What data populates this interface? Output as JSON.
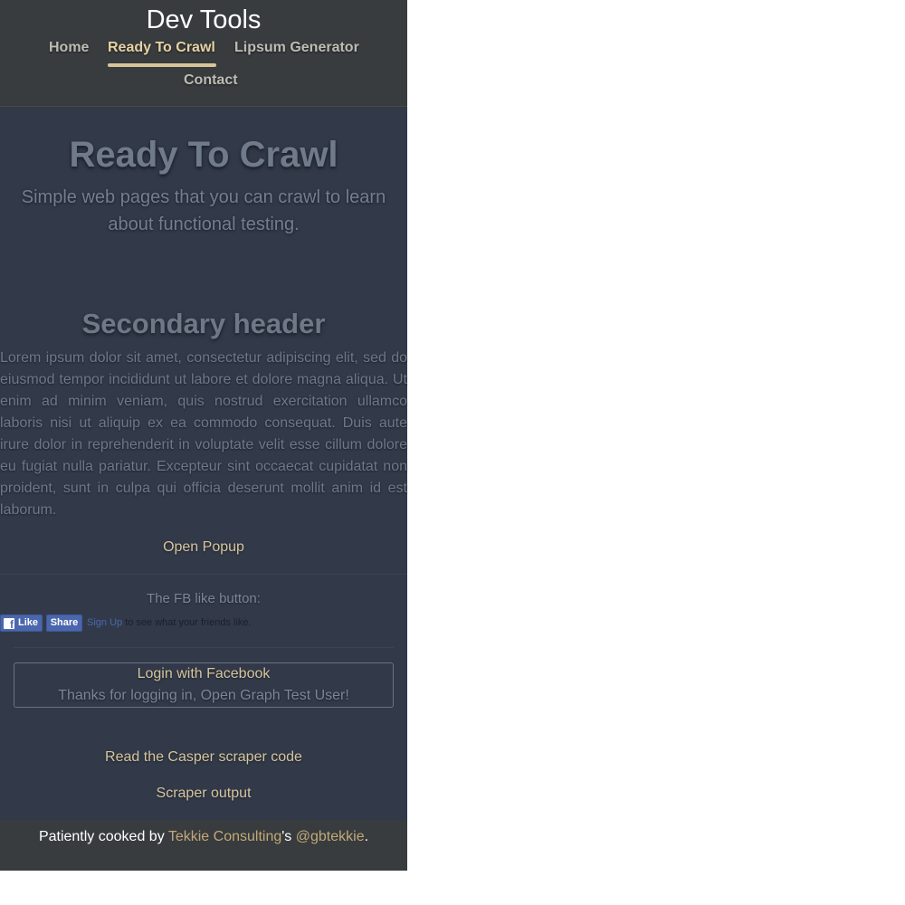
{
  "header": {
    "site_title": "Dev Tools",
    "nav": {
      "home": "Home",
      "ready_to_crawl": "Ready To Crawl",
      "lipsum_generator": "Lipsum Generator",
      "contact": "Contact"
    },
    "active_nav": "Ready To Crawl"
  },
  "main": {
    "title": "Ready To Crawl",
    "subtitle": "Simple web pages that you can crawl to learn about functional testing.",
    "secondary_header": "Secondary header",
    "paragraph": "Lorem ipsum dolor sit amet, consectetur adipiscing elit, sed do eiusmod tempor incididunt ut labore et dolore magna aliqua. Ut enim ad minim veniam, quis nostrud exercitation ullamco laboris nisi ut aliquip ex ea commodo consequat. Duis aute irure dolor in reprehenderit in voluptate velit esse cillum dolore eu fugiat nulla pariatur. Excepteur sint occaecat cupidatat non proident, sunt in culpa qui officia deserunt mollit anim id est laborum.",
    "open_popup": "Open Popup",
    "fb_caption": "The FB like button:",
    "fb_widget": {
      "like": "Like",
      "share": "Share",
      "sign_up": "Sign Up",
      "sign_up_suffix": " to see what your friends like."
    },
    "login": {
      "link": "Login with Facebook",
      "status": "Thanks for logging in, Open Graph Test User!"
    },
    "scraper_code": "Read the Casper scraper code",
    "scraper_output": "Scraper output"
  },
  "footer": {
    "prefix": "Patiently cooked by ",
    "company": "Tekkie Consulting",
    "middle": "'s ",
    "handle": "@gbtekkie",
    "suffix": "."
  },
  "colors": {
    "page_bg": "#323a4a",
    "header_bg": "#383c3e",
    "accent_gold": "#d6c59d",
    "facebook_blue": "#4a66ad"
  }
}
